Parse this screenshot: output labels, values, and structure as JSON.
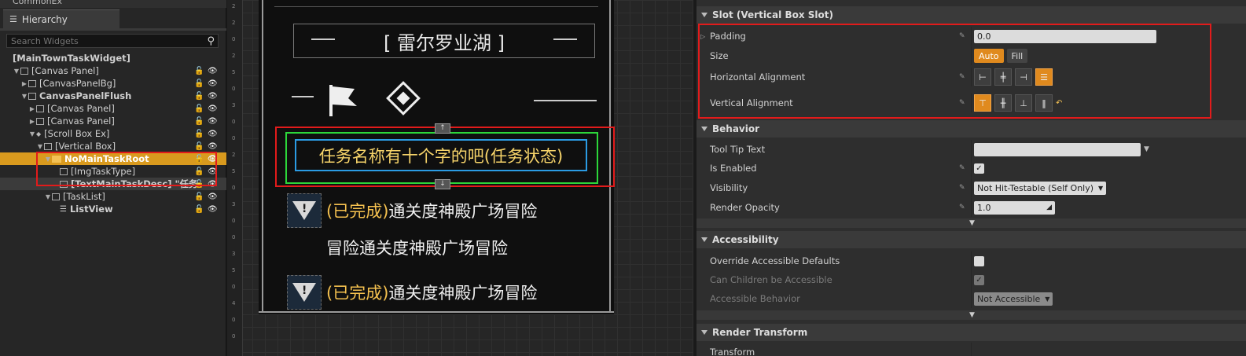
{
  "left_panel": {
    "top_strip_label": "CommonEx",
    "tab_label": "Hierarchy",
    "search_placeholder": "Search Widgets",
    "tree": [
      {
        "label": "[MainTownTaskWidget]",
        "indent": 0,
        "bold": true,
        "arrow": "",
        "icon": "none"
      },
      {
        "label": "[Canvas Panel]",
        "indent": 1,
        "arrow": "▼",
        "icon": "box"
      },
      {
        "label": "[CanvasPanelBg]",
        "indent": 2,
        "arrow": "▶",
        "icon": "box"
      },
      {
        "label": "CanvasPanelFlush",
        "indent": 2,
        "bold": true,
        "arrow": "▼",
        "icon": "box"
      },
      {
        "label": "[Canvas Panel]",
        "indent": 3,
        "arrow": "▶",
        "icon": "box"
      },
      {
        "label": "[Canvas Panel]",
        "indent": 3,
        "arrow": "▶",
        "icon": "box"
      },
      {
        "label": "[Scroll Box Ex]",
        "indent": 3,
        "arrow": "▼",
        "icon": "diamond"
      },
      {
        "label": "[Vertical Box]",
        "indent": 4,
        "arrow": "▼",
        "icon": "box"
      },
      {
        "label": "NoMainTaskRoot",
        "indent": 5,
        "bold": true,
        "arrow": "▼",
        "icon": "folder",
        "selected": true
      },
      {
        "label": "[ImgTaskType]",
        "indent": 6,
        "arrow": "",
        "icon": "box"
      },
      {
        "label": "[TextMainTaskDesc] \"任务",
        "indent": 6,
        "bold": true,
        "arrow": "",
        "icon": "box",
        "hl2": true
      },
      {
        "label": "[TaskList]",
        "indent": 5,
        "arrow": "▼",
        "icon": "box"
      },
      {
        "label": "ListView",
        "indent": 6,
        "bold": true,
        "arrow": "",
        "icon": "list"
      }
    ]
  },
  "canvas": {
    "ruler_labels": [
      "2",
      "2",
      "0",
      "2",
      "5",
      "0",
      "3",
      "0",
      "0",
      "2",
      "5",
      "0",
      "3",
      "0",
      "0",
      "3",
      "5",
      "0",
      "4",
      "0",
      "0"
    ],
    "title": "[ 雷尔罗业湖 ]",
    "task_name": "任务名称有十个字的吧(任务状态)",
    "task_rows": [
      {
        "status": "(已完成)",
        "text": "通关度神殿广场冒险",
        "icon": "warning-icon"
      },
      {
        "status": "",
        "text": "冒险通关度神殿广场冒险",
        "icon": ""
      },
      {
        "status": "(已完成)",
        "text": "通关度神殿广场冒险",
        "icon": "warning-icon"
      }
    ]
  },
  "details": {
    "slot_section": "Slot (Vertical Box Slot)",
    "padding_label": "Padding",
    "padding_value": "0.0",
    "size_label": "Size",
    "size_auto": "Auto",
    "size_fill": "Fill",
    "halign_label": "Horizontal Alignment",
    "valign_label": "Vertical Alignment",
    "behavior_section": "Behavior",
    "tooltip_label": "Tool Tip Text",
    "tooltip_value": "",
    "enabled_label": "Is Enabled",
    "enabled_value": true,
    "visibility_label": "Visibility",
    "visibility_value": "Not Hit-Testable (Self Only)",
    "opacity_label": "Render Opacity",
    "opacity_value": "1.0",
    "accessibility_section": "Accessibility",
    "override_label": "Override Accessible Defaults",
    "override_value": false,
    "children_label": "Can Children be Accessible",
    "children_value": true,
    "accbehavior_label": "Accessible Behavior",
    "accbehavior_value": "Not Accessible",
    "render_section": "Render Transform",
    "transform_label": "Transform"
  },
  "colors": {
    "selection": "#d99a1e",
    "accent_orange": "#e08a1e",
    "highlight_red": "#e21b1b",
    "task_status": "#f5c14f"
  }
}
